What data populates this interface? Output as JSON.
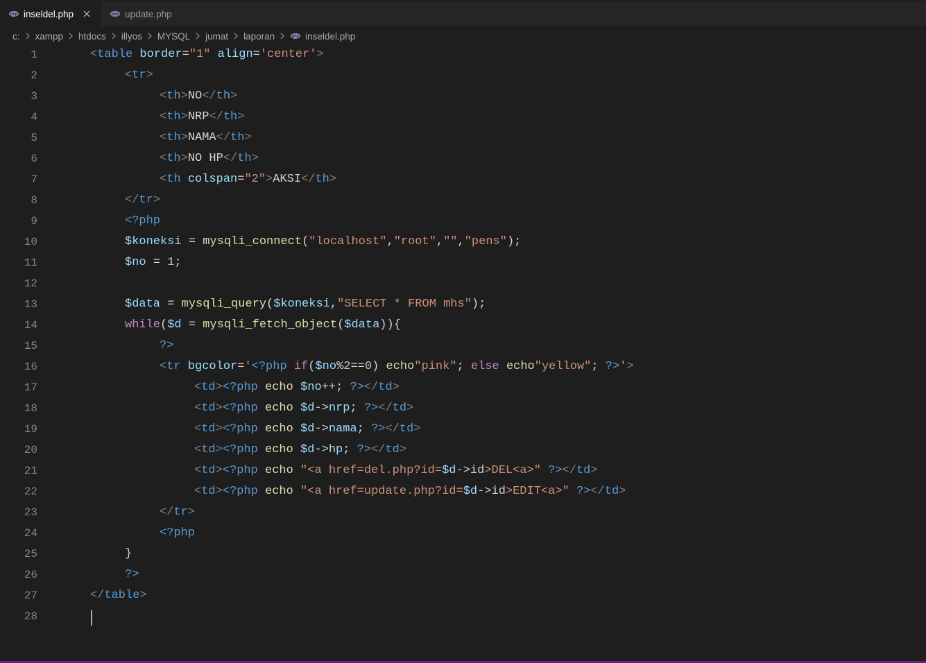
{
  "tabs": [
    {
      "label": "inseldel.php",
      "active": true,
      "closable": true
    },
    {
      "label": "update.php",
      "active": false,
      "closable": false
    }
  ],
  "breadcrumbs": [
    "c:",
    "xampp",
    "htdocs",
    "illyos",
    "MYSQL",
    "jumat",
    "laporan",
    "inseldel.php"
  ],
  "lineCount": 28,
  "code": {
    "l1": {
      "tag": "table",
      "attr1": "border",
      "val1": "\"1\"",
      "attr2": "align",
      "val2": "'center'"
    },
    "l2": {
      "tag": "tr"
    },
    "l3": {
      "tag": "th",
      "content": "NO"
    },
    "l4": {
      "tag": "th",
      "content": "NRP"
    },
    "l5": {
      "tag": "th",
      "content": "NAMA"
    },
    "l6": {
      "tag": "th",
      "content": "NO HP"
    },
    "l7": {
      "tag": "th",
      "attr": "colspan",
      "val": "\"2\"",
      "content": "AKSI"
    },
    "l8": {
      "close": "tr"
    },
    "l9": {
      "php_open": "<?php"
    },
    "l10": {
      "var": "$koneksi",
      "eq": " = ",
      "func": "mysqli_connect",
      "args_s1": "\"localhost\"",
      "args_s2": "\"root\"",
      "args_s3": "\"\"",
      "args_s4": "\"pens\""
    },
    "l11": {
      "var": "$no",
      "eq": " = ",
      "num": "1"
    },
    "l13": {
      "var": "$data",
      "eq": " = ",
      "func": "mysqli_query",
      "arg1": "$koneksi",
      "arg2": "\"SELECT * FROM mhs\""
    },
    "l14": {
      "kw": "while",
      "var1": "$d",
      "func": "mysqli_fetch_object",
      "arg": "$data"
    },
    "l15": {
      "php_close": "?>"
    },
    "l16": {
      "tag": "tr",
      "attr": "bgcolor",
      "php_open": "<?php",
      "kw1": "if",
      "var": "$no",
      "op": "%",
      "num1": "2",
      "eq": "==",
      "num2": "0",
      "echo1": "echo",
      "str1": "\"pink\"",
      "kw2": "else",
      "echo2": "echo",
      "str2": "\"yellow\"",
      "php_close": "?>"
    },
    "l17": {
      "tag": "td",
      "php_open": "<?php",
      "echo": "echo",
      "var": "$no",
      "op": "++",
      "php_close": "?>"
    },
    "l18": {
      "tag": "td",
      "php_open": "<?php",
      "echo": "echo",
      "var": "$d",
      "arrow": "->",
      "prop": "nrp",
      "php_close": "?>"
    },
    "l19": {
      "tag": "td",
      "php_open": "<?php",
      "echo": "echo",
      "var": "$d",
      "arrow": "->",
      "prop": "nama",
      "php_close": "?>"
    },
    "l20": {
      "tag": "td",
      "php_open": "<?php",
      "echo": "echo",
      "var": "$d",
      "arrow": "->",
      "prop": "hp",
      "php_close": "?>"
    },
    "l21": {
      "tag": "td",
      "php_open": "<?php",
      "echo": "echo",
      "str_pre": "\"<a href=del.php?id=",
      "var": "$d",
      "arrow": "->",
      "prop": "id",
      "str_post": ">DEL<a>\"",
      "php_close": "?>"
    },
    "l22": {
      "tag": "td",
      "php_open": "<?php",
      "echo": "echo",
      "str_pre": "\"<a href=update.php?id=",
      "var": "$d",
      "arrow": "->",
      "prop": "id",
      "str_post": ">EDIT<a>\"",
      "php_close": "?>"
    },
    "l23": {
      "close": "tr"
    },
    "l24": {
      "php_open": "<?php"
    },
    "l25": {
      "brace": "}"
    },
    "l26": {
      "php_close": "?>"
    },
    "l27": {
      "close": "table"
    }
  }
}
